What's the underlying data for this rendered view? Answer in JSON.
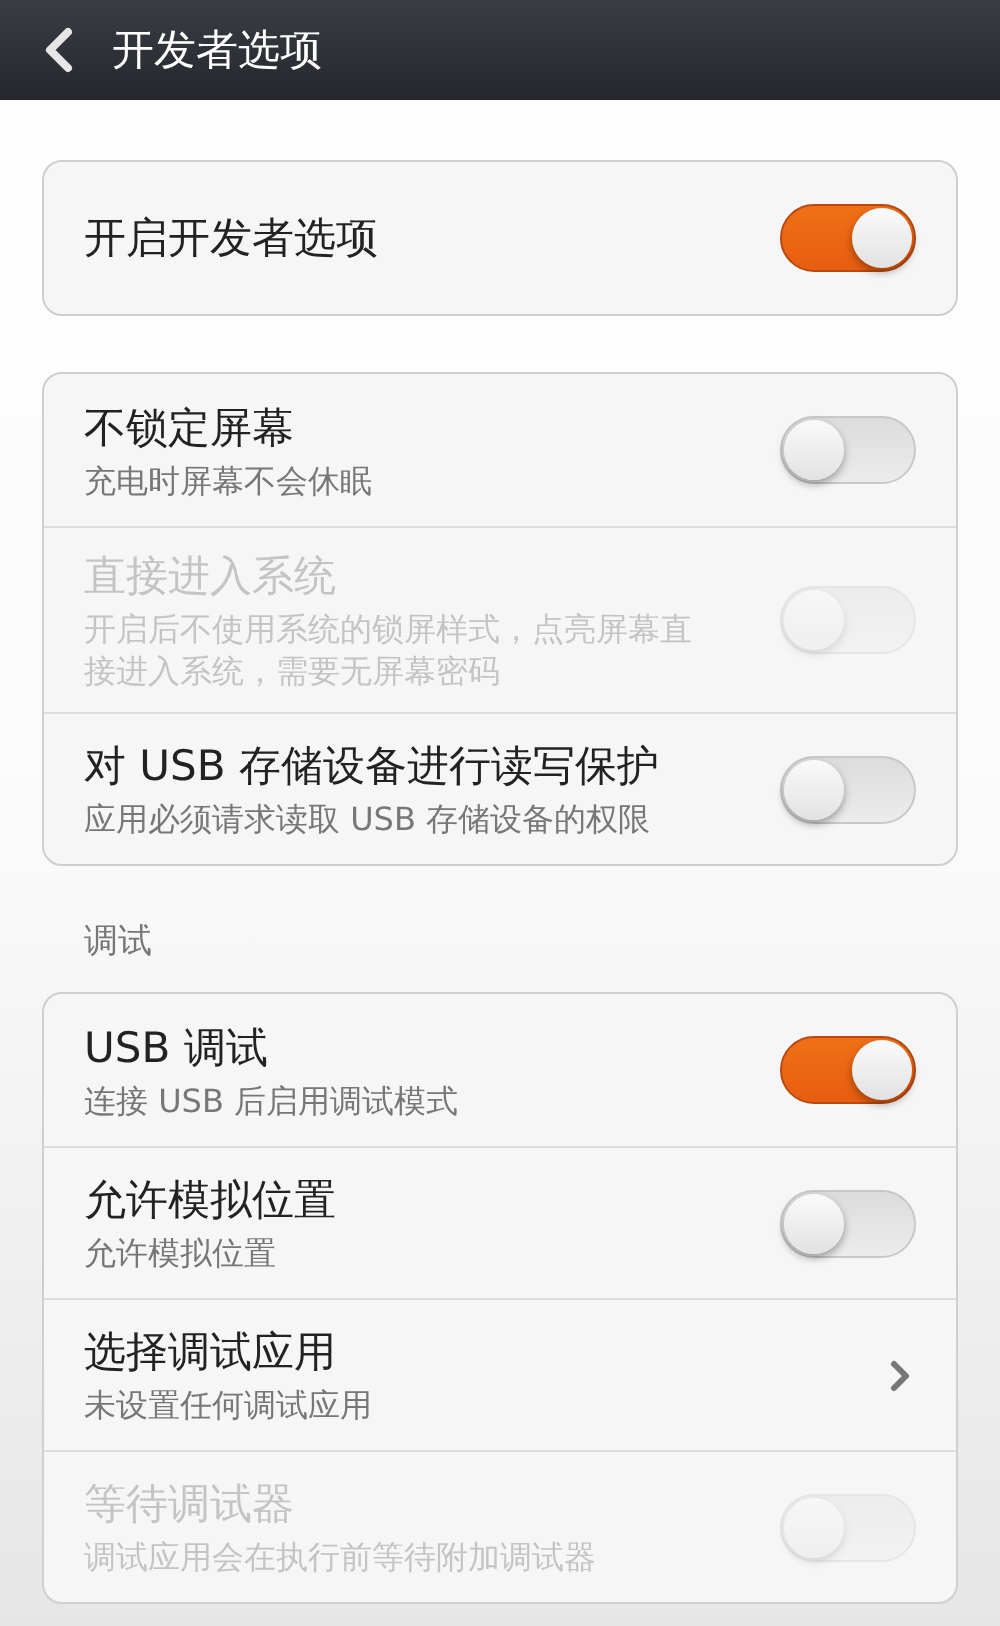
{
  "header": {
    "title": "开发者选项"
  },
  "groups": [
    {
      "items": [
        {
          "kind": "switch",
          "title": "开启开发者选项",
          "on": true,
          "disabled": false
        }
      ]
    },
    {
      "items": [
        {
          "kind": "switch",
          "title": "不锁定屏幕",
          "subtitle": "充电时屏幕不会休眠",
          "on": false,
          "disabled": false
        },
        {
          "kind": "switch",
          "title": "直接进入系统",
          "subtitle": "开启后不使用系统的锁屏样式，点亮屏幕直接进入系统，需要无屏幕密码",
          "on": false,
          "disabled": true
        },
        {
          "kind": "switch",
          "title": "对 USB 存储设备进行读写保护",
          "subtitle": "应用必须请求读取 USB 存储设备的权限",
          "on": false,
          "disabled": false
        }
      ]
    },
    {
      "label": "调试",
      "items": [
        {
          "kind": "switch",
          "title": "USB 调试",
          "subtitle": "连接 USB 后启用调试模式",
          "on": true,
          "disabled": false
        },
        {
          "kind": "switch",
          "title": "允许模拟位置",
          "subtitle": "允许模拟位置",
          "on": false,
          "disabled": false
        },
        {
          "kind": "link",
          "title": "选择调试应用",
          "subtitle": "未设置任何调试应用",
          "disabled": false
        },
        {
          "kind": "switch",
          "title": "等待调试器",
          "subtitle": "调试应用会在执行前等待附加调试器",
          "on": false,
          "disabled": true
        }
      ]
    }
  ]
}
